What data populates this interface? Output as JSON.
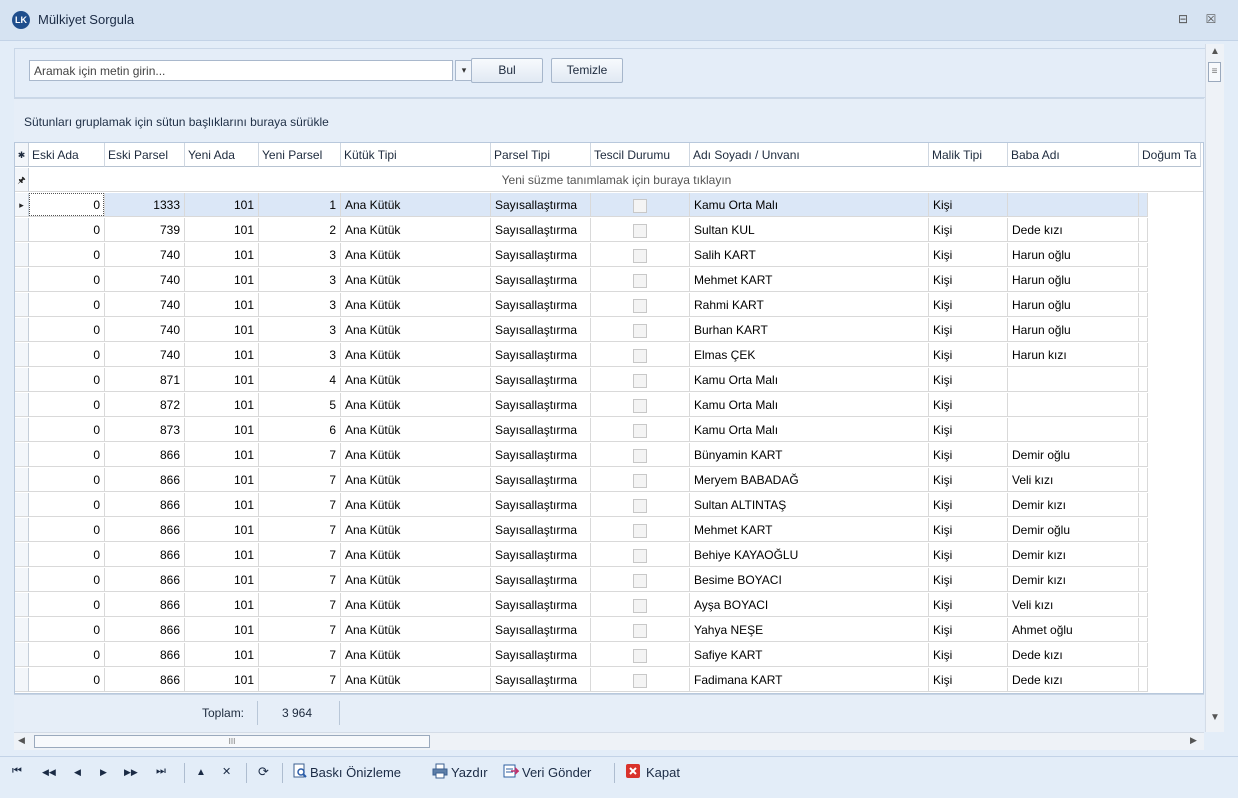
{
  "window": {
    "title": "Mülkiyet Sorgula",
    "icon": "LK",
    "minimize_glyph": "⊟",
    "close_glyph": "☒"
  },
  "search": {
    "placeholder": "Aramak için metin girin...",
    "dropdown_glyph": "▾",
    "find_label": "Bul",
    "clear_label": "Temizle"
  },
  "group_panel_text": "Sütunları gruplamak için sütun başlıklarını buraya sürükle",
  "grid": {
    "columns": [
      "Eski Ada",
      "Eski Parsel",
      "Yeni Ada",
      "Yeni Parsel",
      "Kütük Tipi",
      "Parsel Tipi",
      "Tescil Durumu",
      "Adı Soyadı / Unvanı",
      "Malik Tipi",
      "Baba Adı",
      "Doğum Ta"
    ],
    "filter_row_text": "Yeni süzme tanımlamak için buraya tıklayın",
    "header_indicator_glyph": "✱",
    "filter_indicator_glyph": "🖈",
    "current_row_glyph": "▸",
    "rows": [
      [
        "0",
        "1333",
        "101",
        "1",
        "Ana Kütük",
        "Sayısallaştırma",
        "",
        "Kamu Orta Malı",
        "Kişi",
        "",
        ""
      ],
      [
        "0",
        "739",
        "101",
        "2",
        "Ana Kütük",
        "Sayısallaştırma",
        "",
        "Sultan KUL",
        "Kişi",
        "Dede kızı",
        ""
      ],
      [
        "0",
        "740",
        "101",
        "3",
        "Ana Kütük",
        "Sayısallaştırma",
        "",
        "Salih KART",
        "Kişi",
        "Harun oğlu",
        ""
      ],
      [
        "0",
        "740",
        "101",
        "3",
        "Ana Kütük",
        "Sayısallaştırma",
        "",
        "Mehmet KART",
        "Kişi",
        "Harun oğlu",
        ""
      ],
      [
        "0",
        "740",
        "101",
        "3",
        "Ana Kütük",
        "Sayısallaştırma",
        "",
        "Rahmi KART",
        "Kişi",
        "Harun oğlu",
        ""
      ],
      [
        "0",
        "740",
        "101",
        "3",
        "Ana Kütük",
        "Sayısallaştırma",
        "",
        "Burhan KART",
        "Kişi",
        "Harun oğlu",
        ""
      ],
      [
        "0",
        "740",
        "101",
        "3",
        "Ana Kütük",
        "Sayısallaştırma",
        "",
        "Elmas ÇEK",
        "Kişi",
        "Harun kızı",
        ""
      ],
      [
        "0",
        "871",
        "101",
        "4",
        "Ana Kütük",
        "Sayısallaştırma",
        "",
        "Kamu Orta Malı",
        "Kişi",
        "",
        ""
      ],
      [
        "0",
        "872",
        "101",
        "5",
        "Ana Kütük",
        "Sayısallaştırma",
        "",
        "Kamu Orta Malı",
        "Kişi",
        "",
        ""
      ],
      [
        "0",
        "873",
        "101",
        "6",
        "Ana Kütük",
        "Sayısallaştırma",
        "",
        "Kamu Orta Malı",
        "Kişi",
        "",
        ""
      ],
      [
        "0",
        "866",
        "101",
        "7",
        "Ana Kütük",
        "Sayısallaştırma",
        "",
        "Bünyamin KART",
        "Kişi",
        "Demir oğlu",
        ""
      ],
      [
        "0",
        "866",
        "101",
        "7",
        "Ana Kütük",
        "Sayısallaştırma",
        "",
        "Meryem BABADAĞ",
        "Kişi",
        "Veli kızı",
        ""
      ],
      [
        "0",
        "866",
        "101",
        "7",
        "Ana Kütük",
        "Sayısallaştırma",
        "",
        "Sultan ALTINTAŞ",
        "Kişi",
        "Demir kızı",
        ""
      ],
      [
        "0",
        "866",
        "101",
        "7",
        "Ana Kütük",
        "Sayısallaştırma",
        "",
        "Mehmet KART",
        "Kişi",
        "Demir oğlu",
        ""
      ],
      [
        "0",
        "866",
        "101",
        "7",
        "Ana Kütük",
        "Sayısallaştırma",
        "",
        "Behiye KAYAOĞLU",
        "Kişi",
        "Demir kızı",
        ""
      ],
      [
        "0",
        "866",
        "101",
        "7",
        "Ana Kütük",
        "Sayısallaştırma",
        "",
        "Besime BOYACI",
        "Kişi",
        "Demir kızı",
        ""
      ],
      [
        "0",
        "866",
        "101",
        "7",
        "Ana Kütük",
        "Sayısallaştırma",
        "",
        "Ayşa BOYACI",
        "Kişi",
        "Veli kızı",
        ""
      ],
      [
        "0",
        "866",
        "101",
        "7",
        "Ana Kütük",
        "Sayısallaştırma",
        "",
        "Yahya NEŞE",
        "Kişi",
        "Ahmet oğlu",
        ""
      ],
      [
        "0",
        "866",
        "101",
        "7",
        "Ana Kütük",
        "Sayısallaştırma",
        "",
        "Safiye KART",
        "Kişi",
        "Dede kızı",
        ""
      ],
      [
        "0",
        "866",
        "101",
        "7",
        "Ana Kütük",
        "Sayısallaştırma",
        "",
        "Fadimana KART",
        "Kişi",
        "Dede kızı",
        ""
      ]
    ]
  },
  "footer": {
    "total_label": "Toplam:",
    "total_value": "3 964"
  },
  "scroll": {
    "up": "▲",
    "down": "▼",
    "left": "◀",
    "right": "▶",
    "thumb_grip": "III",
    "vthumb_grip": "≡"
  },
  "navigator": {
    "first": "⏮",
    "prev_page": "◀◀",
    "prev": "◀",
    "next": "▶",
    "next_page": "▶▶",
    "last": "⏭",
    "append": "▲",
    "delete": "✕",
    "refresh": "⟳",
    "print_preview_label": "Baskı Önizleme",
    "print_label": "Yazdır",
    "send_data_label": "Veri Gönder",
    "close_label": "Kapat"
  },
  "colors": {
    "selected_row": "#dbe7f7",
    "close_icon": "#d9322b",
    "title_icon": "#1f4e8c"
  }
}
